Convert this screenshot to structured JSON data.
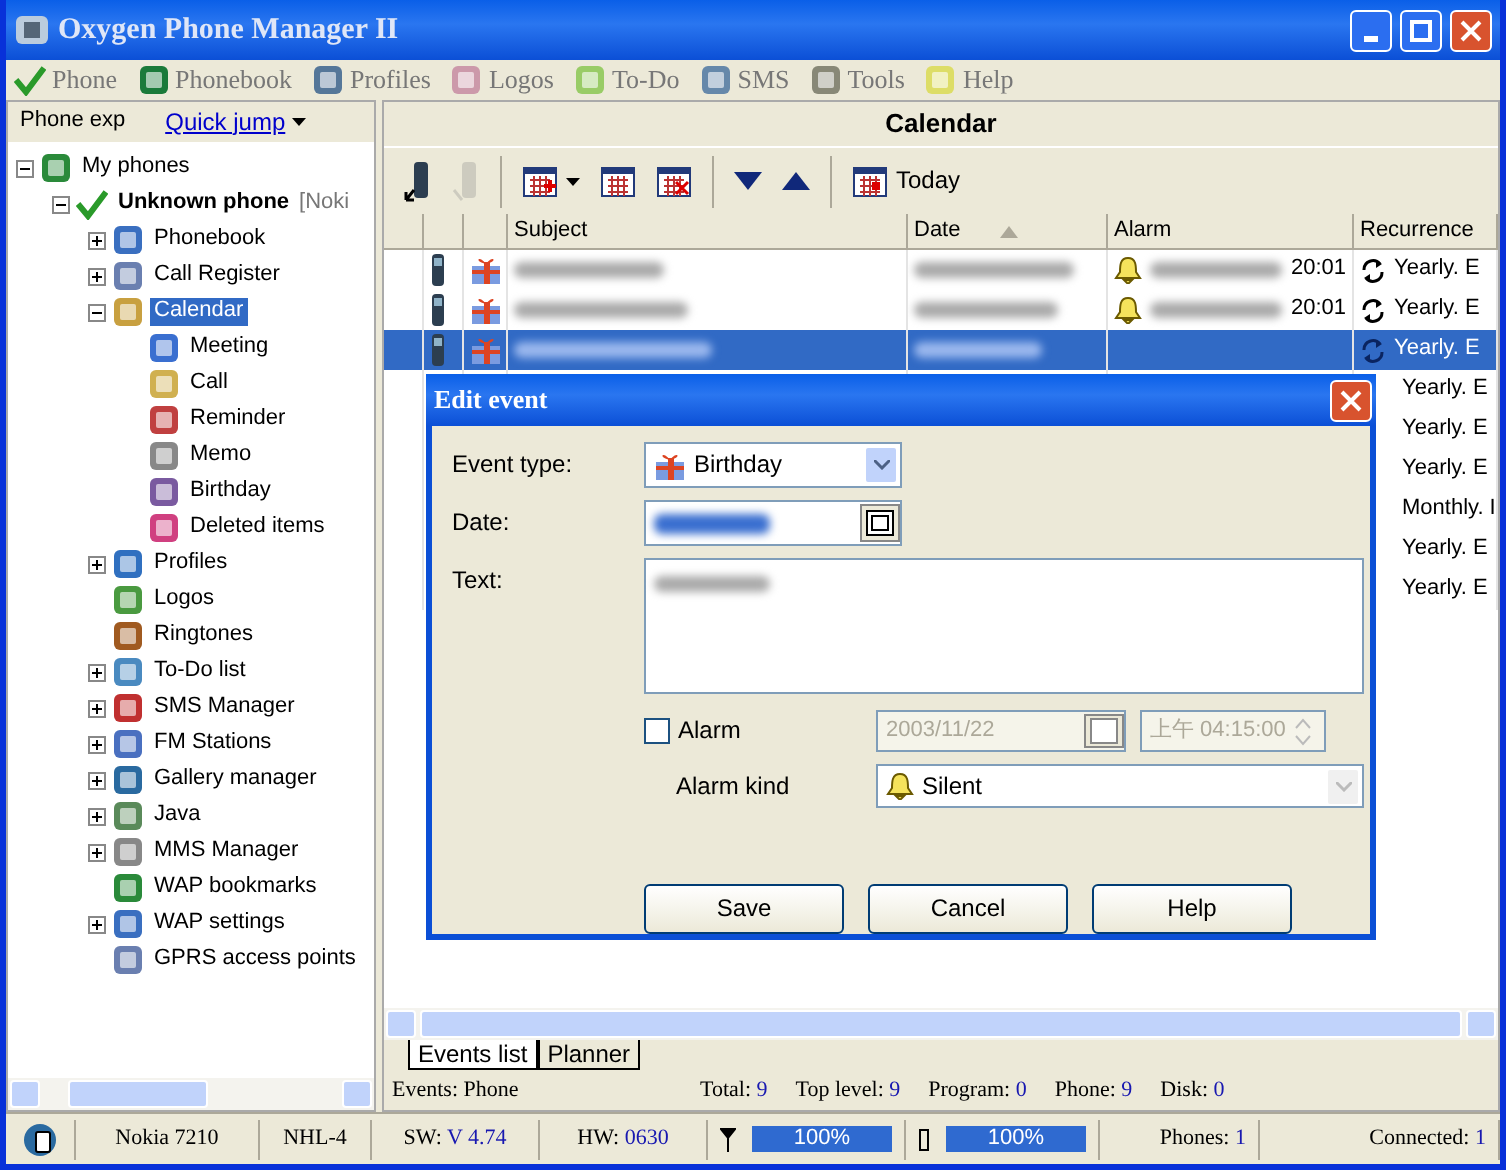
{
  "window": {
    "title": "Oxygen Phone Manager II"
  },
  "menu": [
    {
      "kind": "phone",
      "label": "Phone"
    },
    {
      "kind": "phonebook",
      "label": "Phonebook"
    },
    {
      "kind": "profiles",
      "label": "Profiles"
    },
    {
      "kind": "logos",
      "label": "Logos"
    },
    {
      "kind": "todo",
      "label": "To-Do"
    },
    {
      "kind": "sms",
      "label": "SMS"
    },
    {
      "kind": "tools",
      "label": "Tools"
    },
    {
      "kind": "help",
      "label": "Help"
    }
  ],
  "left_pane": {
    "tab": "Phone exp",
    "quick_jump": "Quick jump",
    "tree": [
      {
        "label": "My phones",
        "selected": false,
        "expanded": true,
        "children": [
          {
            "label": "Unknown phone",
            "detail": "[Noki",
            "selected": false,
            "expanded": true,
            "children": [
              {
                "label": "Phonebook",
                "selected": false,
                "expanded": false
              },
              {
                "label": "Call Register",
                "selected": false,
                "expanded": false
              },
              {
                "label": "Calendar",
                "selected": true,
                "expanded": true,
                "children": [
                  {
                    "label": "Meeting",
                    "selected": false
                  },
                  {
                    "label": "Call",
                    "selected": false
                  },
                  {
                    "label": "Reminder",
                    "selected": false
                  },
                  {
                    "label": "Memo",
                    "selected": false
                  },
                  {
                    "label": "Birthday",
                    "selected": false
                  },
                  {
                    "label": "Deleted items",
                    "selected": false
                  }
                ]
              },
              {
                "label": "Profiles",
                "selected": false,
                "expanded": false
              },
              {
                "label": "Logos",
                "selected": false
              },
              {
                "label": "Ringtones",
                "selected": false
              },
              {
                "label": "To-Do list",
                "selected": false,
                "expanded": false
              },
              {
                "label": "SMS Manager",
                "selected": false,
                "expanded": false
              },
              {
                "label": "FM Stations",
                "selected": false,
                "expanded": false
              },
              {
                "label": "Gallery manager",
                "selected": false,
                "expanded": false
              },
              {
                "label": "Java",
                "selected": false,
                "expanded": false
              },
              {
                "label": "MMS Manager",
                "selected": false,
                "expanded": false
              },
              {
                "label": "WAP bookmarks",
                "selected": false
              },
              {
                "label": "WAP settings",
                "selected": false,
                "expanded": false
              },
              {
                "label": "GPRS access points",
                "selected": false
              }
            ]
          }
        ]
      }
    ]
  },
  "right_pane": {
    "title": "Calendar",
    "toolbar": [
      {
        "kind": "phone-read",
        "disabled": false
      },
      {
        "kind": "phone-write",
        "disabled": true
      },
      {
        "kind": "add",
        "disabled": false
      },
      {
        "kind": "edit",
        "disabled": false
      },
      {
        "kind": "delete",
        "disabled": false
      },
      {
        "kind": "down",
        "disabled": false
      },
      {
        "kind": "up",
        "disabled": false
      },
      {
        "kind": "today",
        "disabled": false,
        "label": "Today"
      }
    ],
    "table": {
      "columns": [
        {
          "label": "Subject"
        },
        {
          "label": "Date",
          "sorted": true
        },
        {
          "label": "Alarm"
        },
        {
          "label": "Recurrence"
        }
      ],
      "rows": [
        {
          "selected": false,
          "blurred": true,
          "alarm": "20:01",
          "recurrence": "Yearly. E"
        },
        {
          "selected": false,
          "blurred": true,
          "alarm": "20:01",
          "recurrence": "Yearly. E"
        },
        {
          "selected": true,
          "blurred": true,
          "recurrence": "Yearly. E"
        },
        {
          "selected": false,
          "recurrence": "Yearly. E"
        },
        {
          "selected": false,
          "recurrence": "Yearly. E"
        },
        {
          "selected": false,
          "recurrence": "Yearly. E"
        },
        {
          "selected": false,
          "recurrence": "Monthly. I"
        },
        {
          "selected": false,
          "recurrence": "Yearly. E"
        },
        {
          "selected": false,
          "recurrence": "Yearly. E"
        }
      ]
    },
    "tabs": [
      {
        "label": "Events list",
        "selected": true
      },
      {
        "label": "Planner",
        "selected": false
      }
    ],
    "status": {
      "events": "Events: Phone",
      "counts": [
        {
          "label": "Total:",
          "value": "9"
        },
        {
          "label": "Top level:",
          "value": "9"
        },
        {
          "label": "Program:",
          "value": "0"
        },
        {
          "label": "Phone:",
          "value": "9"
        },
        {
          "label": "Disk:",
          "value": "0"
        }
      ]
    }
  },
  "status_bar": {
    "model": "Nokia 7210",
    "code": "NHL-4",
    "sw": {
      "label": "SW:",
      "value": "V 4.74"
    },
    "hw": {
      "label": "HW:",
      "value": "0630"
    },
    "signal": {
      "level": 1,
      "reading": "100%"
    },
    "battery": {
      "level": 1,
      "reading": "100%"
    },
    "phones": {
      "label": "Phones:",
      "value": "1"
    },
    "connected": {
      "label": "Connected:",
      "value": "1"
    }
  },
  "dialog": {
    "title": "Edit event",
    "event_type_label": "Event type:",
    "event_type": "Birthday",
    "date_label": "Date:",
    "text_label": "Text:",
    "alarm": {
      "label": "Alarm",
      "checked": false,
      "date": "2003/11/22",
      "time": "上午 04:15:00"
    },
    "alarm_kind_label": "Alarm kind",
    "alarm_kind": "Silent",
    "buttons": [
      "Save",
      "Cancel",
      "Help"
    ]
  }
}
